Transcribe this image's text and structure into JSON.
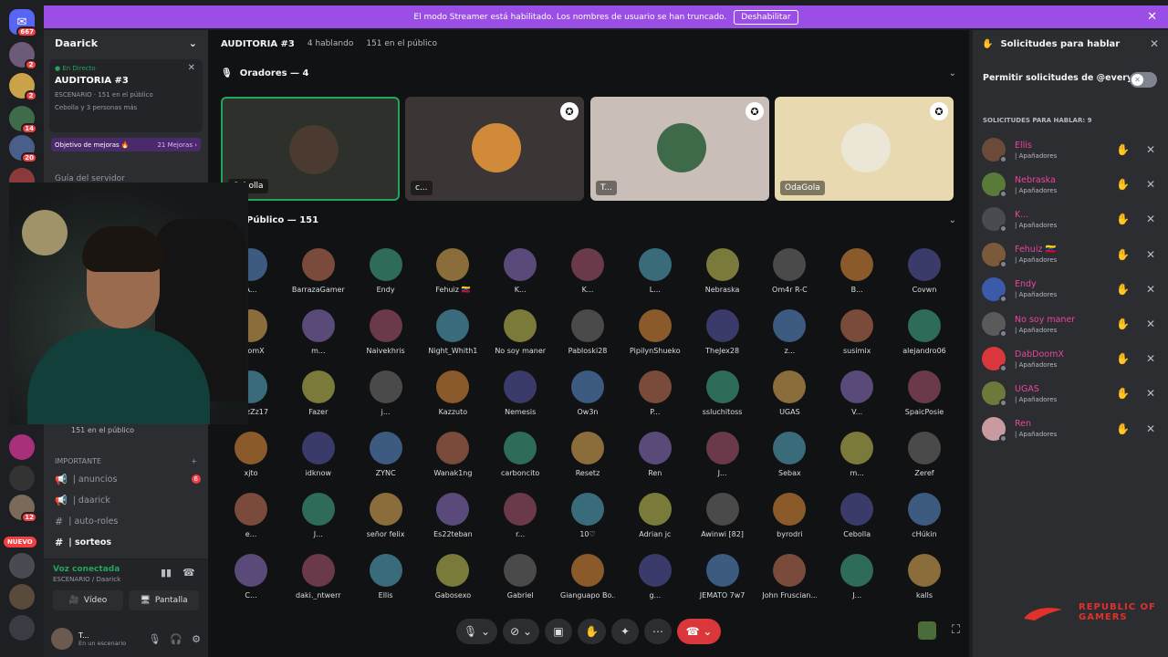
{
  "banner": {
    "message": "El modo Streamer está habilitado. Los nombres de usuario se han truncado.",
    "button": "Deshabilitar",
    "close": "✕"
  },
  "rail": {
    "home_badge": "667",
    "badges": [
      "2",
      "2",
      "14",
      "20",
      "1",
      "2",
      "29",
      "12"
    ],
    "new_label": "NUEVO"
  },
  "sidebar": {
    "server_name": "Daarick",
    "live": {
      "tag": "● En Directo",
      "title": "AUDITORIA #3",
      "meta1": "ESCENARIO · 151 en el público",
      "meta2": "Cebolla y 3 personas más"
    },
    "goal": {
      "label": "Objetivo de mejoras 🔥",
      "count": "21 Mejoras ›"
    },
    "guide": "Guía del servidor",
    "audience": "151 en el público",
    "category": "IMPORTANTE",
    "channels": [
      {
        "name": "| anuncios",
        "badge": "6"
      },
      {
        "name": "| daarick",
        "badge": ""
      },
      {
        "name": "| auto-roles",
        "badge": ""
      },
      {
        "name": "| sorteos",
        "badge": ""
      }
    ],
    "voice": {
      "status": "Voz conectada",
      "sub": "ESCENARIO / Daarick",
      "video": "Vídeo",
      "screen": "Pantalla"
    },
    "user": {
      "name": "T...",
      "status": "En un escenario"
    }
  },
  "main": {
    "title": "AUDITORIA #3",
    "speaking": "4 hablando",
    "audience_count": "151 en el público",
    "speakers_header": "Oradores — 4",
    "audience_header": "Público — 151",
    "speakers": [
      {
        "name": "Cebolla",
        "bg": "#2e302b",
        "av": "#4a3a30"
      },
      {
        "name": "c...",
        "bg": "#3b3535",
        "av": "#d08a3a"
      },
      {
        "name": "T...",
        "bg": "#c9bfb8",
        "av": "#3f6a4a"
      },
      {
        "name": "OdaGola",
        "bg": "#e8d9b0",
        "av": "#ece6d6"
      }
    ],
    "audience_rows": [
      [
        "A...",
        "BarrazaGamer",
        "Endy",
        "Fehuiz 🇻🇪",
        "K...",
        "K...",
        "L...",
        "Nebraska",
        "Om4r R-C",
        "B...",
        "Covwn"
      ],
      [
        "DoomX",
        "m...",
        "Naivekhris",
        "Night_Whith1",
        "No soy maner",
        "Pabloski28",
        "PipilynShueko",
        "TheJex28",
        "z...",
        "susimix",
        "alejandro06"
      ],
      [
        "FabzZz17",
        "Fazer",
        "j...",
        "Kazzuto",
        "Nemesis",
        "Ow3n",
        "P...",
        "ssluchitoss",
        "UGAS",
        "V...",
        "SpaicPosie"
      ],
      [
        "xjto",
        "idknow",
        "ZYNC",
        "Wanak1ng",
        "carboncito",
        "Resetz",
        "Ren",
        "J...",
        "Sebax",
        "m...",
        "Zeref"
      ],
      [
        "e...",
        "J...",
        "señor felix",
        "Es22teban",
        "r...",
        "10♡",
        "Adrian jc",
        "Awinwi ⁅82⁆",
        "byrodri",
        "Cebolla",
        "cHúkin"
      ],
      [
        "C...",
        "daki._ntwerr",
        "Ellis",
        "Gabosexo",
        "Gabriel",
        "Gianguapo Bo...",
        "g...",
        "JEMATO 7w7",
        "John Fruscian...",
        "J...",
        "kalls"
      ]
    ]
  },
  "rpanel": {
    "title": "Solicitudes para hablar",
    "permit": "Permitir solicitudes de @everyone",
    "requests_header": "SOLICITUDES PARA HABLAR: 9",
    "sub": "| Apañadores",
    "requests": [
      "Ellis",
      "Nebraska",
      "K...",
      "Fehuiz 🇻🇪",
      "Endy",
      "No soy maner",
      "DabDoomX",
      "UGAS",
      "Ren"
    ]
  },
  "brand": {
    "line1": "REPUBLIC OF",
    "line2": "GAMERS"
  },
  "colors": {
    "accent": "#5865f2",
    "streamer": "#9b4ee6",
    "speaking": "#23a55a",
    "danger": "#da373c",
    "role": "#eb459e"
  }
}
